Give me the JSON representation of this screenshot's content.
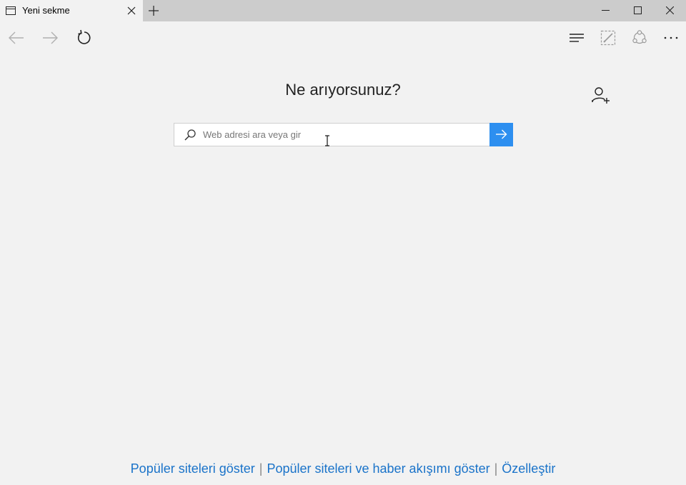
{
  "tab": {
    "title": "Yeni sekme",
    "icon": "page-icon"
  },
  "window_controls": {
    "minimize_icon": "minimize-icon",
    "maximize_icon": "maximize-icon",
    "close_icon": "close-icon"
  },
  "toolbar": {
    "back_icon": "back-arrow-icon",
    "forward_icon": "forward-arrow-icon",
    "refresh_icon": "refresh-icon",
    "hub_icon": "hub-icon",
    "notes_icon": "web-note-icon",
    "share_icon": "share-icon",
    "more_icon": "more-icon"
  },
  "main": {
    "heading": "Ne arıyorsunuz?",
    "add_user_icon": "add-user-icon"
  },
  "search": {
    "placeholder": "Web adresi ara veya gir",
    "value": "",
    "go_icon": "go-arrow-icon"
  },
  "footer": {
    "link1": "Popüler siteleri göster",
    "separator": "|",
    "link2": "Popüler siteleri ve haber akışımı göster",
    "link3": "Özelleştir"
  },
  "colors": {
    "background": "#f2f2f2",
    "tabbar": "#cccccc",
    "accent": "#2d8ff0",
    "link": "#1a73c9"
  }
}
